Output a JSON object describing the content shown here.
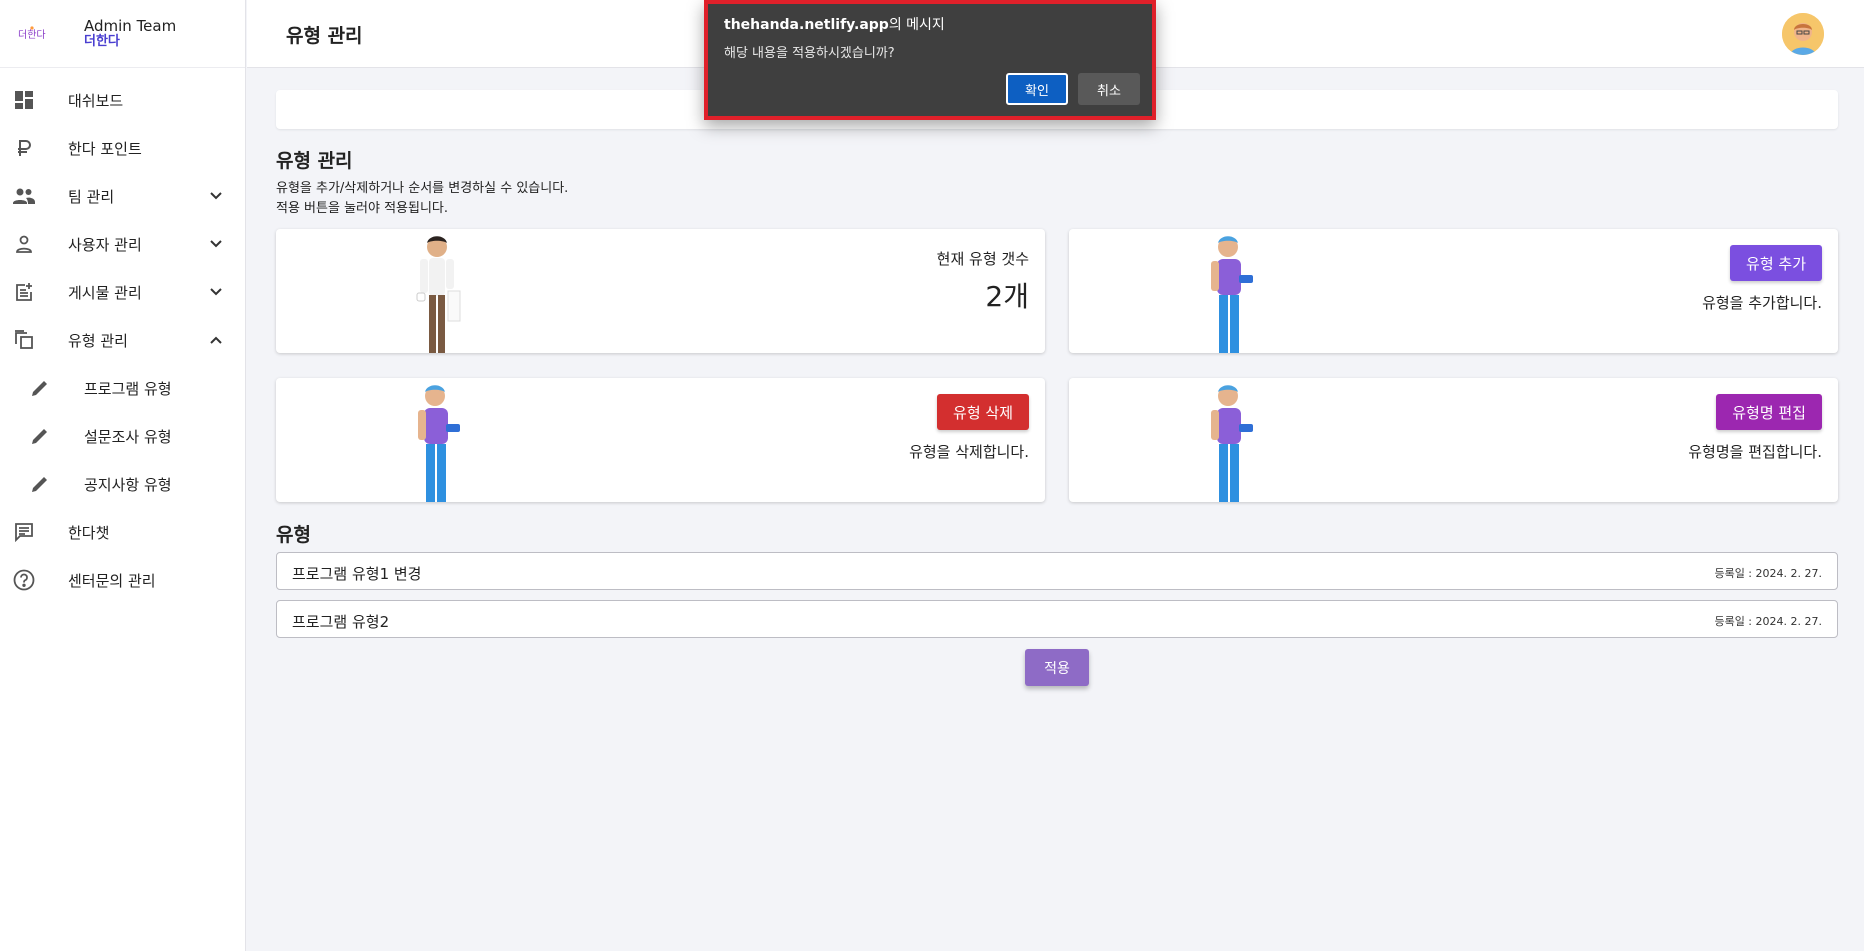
{
  "brand": {
    "logo_text": "더한다",
    "title": "Admin Team",
    "subtitle": "더한다"
  },
  "header": {
    "title": "유형 관리"
  },
  "sidebar": {
    "items": [
      {
        "label": "대쉬보드",
        "icon": "dashboard-icon"
      },
      {
        "label": "한다 포인트",
        "icon": "ruble-icon"
      },
      {
        "label": "팀 관리",
        "icon": "people-icon",
        "chevron": "down"
      },
      {
        "label": "사용자 관리",
        "icon": "person-icon",
        "chevron": "down"
      },
      {
        "label": "게시물 관리",
        "icon": "post-add-icon",
        "chevron": "down"
      },
      {
        "label": "유형 관리",
        "icon": "copy-icon",
        "chevron": "up"
      },
      {
        "label": "프로그램 유형",
        "icon": "pencil-icon",
        "sub": true
      },
      {
        "label": "설문조사 유형",
        "icon": "pencil-icon",
        "sub": true
      },
      {
        "label": "공지사항 유형",
        "icon": "pencil-icon",
        "sub": true
      },
      {
        "label": "한다챗",
        "icon": "chat-icon"
      },
      {
        "label": "센터문의 관리",
        "icon": "help-icon"
      }
    ]
  },
  "section": {
    "title": "유형 관리",
    "desc_line1": "유형을 추가/삭제하거나 순서를 변경하실 수 있습니다.",
    "desc_line2": "적용 버튼을 눌러야 적용됩니다."
  },
  "cards": {
    "count": {
      "label": "현재 유형 갯수",
      "value": "2개"
    },
    "add": {
      "button": "유형 추가",
      "desc": "유형을 추가합니다.",
      "color": "#7b4fe0"
    },
    "delete": {
      "button": "유형 삭제",
      "desc": "유형을 삭제합니다.",
      "color": "#d32f2f"
    },
    "edit": {
      "button": "유형명 편집",
      "desc": "유형명을 편집합니다.",
      "color": "#9c27b0"
    }
  },
  "list": {
    "title": "유형",
    "rows": [
      {
        "name": "프로그램 유형1 변경",
        "date": "등록일 : 2024. 2. 27."
      },
      {
        "name": "프로그램 유형2",
        "date": "등록일 : 2024. 2. 27."
      }
    ]
  },
  "apply_button": "적용",
  "dialog": {
    "origin": "thehanda.netlify.app",
    "title_suffix": "의 메시지",
    "message": "해당 내용을 적용하시겠습니까?",
    "ok": "확인",
    "cancel": "취소"
  },
  "colors": {
    "accent": "#4a3fd0",
    "apply": "#8e6bc6",
    "dialog_border": "#e0202a"
  }
}
